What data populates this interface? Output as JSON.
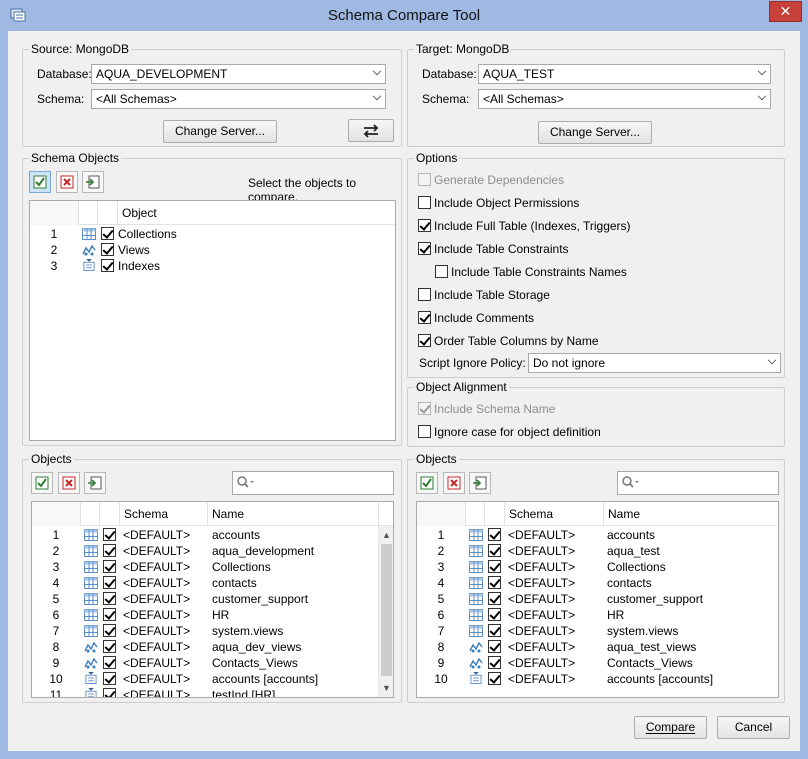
{
  "window": {
    "title": "Schema Compare Tool",
    "close_label": "✕"
  },
  "source": {
    "group_title": "Source: MongoDB",
    "database_label": "Database:",
    "database_value": "AQUA_DEVELOPMENT",
    "schema_label": "Schema:",
    "schema_value": "<All Schemas>",
    "change_server": "Change Server...",
    "swap_icon": "swap-arrows-icon"
  },
  "target": {
    "group_title": "Target: MongoDB",
    "database_label": "Database:",
    "database_value": "AQUA_TEST",
    "schema_label": "Schema:",
    "schema_value": "<All Schemas>",
    "change_server": "Change Server..."
  },
  "schema_objects": {
    "group_title": "Schema Objects",
    "hint": "Select the objects to compare.",
    "column_object": "Object",
    "rows": [
      {
        "n": "1",
        "label": "Collections",
        "icon": "table-icon"
      },
      {
        "n": "2",
        "label": "Views",
        "icon": "view-icon"
      },
      {
        "n": "3",
        "label": "Indexes",
        "icon": "index-icon"
      }
    ]
  },
  "options": {
    "group_title": "Options",
    "items": [
      {
        "label": "Generate Dependencies",
        "checked": false,
        "disabled": true
      },
      {
        "label": "Include Object Permissions",
        "checked": false,
        "disabled": false
      },
      {
        "label": "Include Full Table (Indexes, Triggers)",
        "checked": true,
        "disabled": false
      },
      {
        "label": "Include Table Constraints",
        "checked": true,
        "disabled": false
      },
      {
        "label": "Include Table Constraints Names",
        "checked": false,
        "disabled": false
      },
      {
        "label": "Include Table Storage",
        "checked": false,
        "disabled": false
      },
      {
        "label": "Include Comments",
        "checked": true,
        "disabled": false
      },
      {
        "label": "Order Table Columns by Name",
        "checked": true,
        "disabled": false
      }
    ],
    "ignore_policy_label": "Script Ignore Policy:",
    "ignore_policy_value": "Do not ignore"
  },
  "alignment": {
    "group_title": "Object Alignment",
    "items": [
      {
        "label": "Include Schema Name",
        "checked": true,
        "disabled": true
      },
      {
        "label": "Ignore case for object definition",
        "checked": false,
        "disabled": false
      }
    ]
  },
  "left_objects": {
    "group_title": "Objects",
    "col_schema": "Schema",
    "col_name": "Name",
    "rows": [
      {
        "n": "1",
        "schema": "<DEFAULT>",
        "name": "accounts",
        "icon": "table-icon"
      },
      {
        "n": "2",
        "schema": "<DEFAULT>",
        "name": "aqua_development",
        "icon": "table-icon"
      },
      {
        "n": "3",
        "schema": "<DEFAULT>",
        "name": "Collections",
        "icon": "table-icon"
      },
      {
        "n": "4",
        "schema": "<DEFAULT>",
        "name": "contacts",
        "icon": "table-icon"
      },
      {
        "n": "5",
        "schema": "<DEFAULT>",
        "name": "customer_support",
        "icon": "table-icon"
      },
      {
        "n": "6",
        "schema": "<DEFAULT>",
        "name": "HR",
        "icon": "table-icon"
      },
      {
        "n": "7",
        "schema": "<DEFAULT>",
        "name": "system.views",
        "icon": "table-icon"
      },
      {
        "n": "8",
        "schema": "<DEFAULT>",
        "name": "aqua_dev_views",
        "icon": "view-icon"
      },
      {
        "n": "9",
        "schema": "<DEFAULT>",
        "name": "Contacts_Views",
        "icon": "view-icon"
      },
      {
        "n": "10",
        "schema": "<DEFAULT>",
        "name": "accounts [accounts]",
        "icon": "index-icon"
      },
      {
        "n": "11",
        "schema": "<DEFAULT>",
        "name": "testInd [HR]",
        "icon": "index-icon"
      }
    ]
  },
  "right_objects": {
    "group_title": "Objects",
    "col_schema": "Schema",
    "col_name": "Name",
    "rows": [
      {
        "n": "1",
        "schema": "<DEFAULT>",
        "name": "accounts",
        "icon": "table-icon"
      },
      {
        "n": "2",
        "schema": "<DEFAULT>",
        "name": "aqua_test",
        "icon": "table-icon"
      },
      {
        "n": "3",
        "schema": "<DEFAULT>",
        "name": "Collections",
        "icon": "table-icon"
      },
      {
        "n": "4",
        "schema": "<DEFAULT>",
        "name": "contacts",
        "icon": "table-icon"
      },
      {
        "n": "5",
        "schema": "<DEFAULT>",
        "name": "customer_support",
        "icon": "table-icon"
      },
      {
        "n": "6",
        "schema": "<DEFAULT>",
        "name": "HR",
        "icon": "table-icon"
      },
      {
        "n": "7",
        "schema": "<DEFAULT>",
        "name": "system.views",
        "icon": "table-icon"
      },
      {
        "n": "8",
        "schema": "<DEFAULT>",
        "name": "aqua_test_views",
        "icon": "view-icon"
      },
      {
        "n": "9",
        "schema": "<DEFAULT>",
        "name": "Contacts_Views",
        "icon": "view-icon"
      },
      {
        "n": "10",
        "schema": "<DEFAULT>",
        "name": "accounts [accounts]",
        "icon": "index-icon"
      }
    ]
  },
  "footer": {
    "compare": "Compare",
    "cancel": "Cancel"
  },
  "colors": {
    "title_bar": "#9fb9e2",
    "close": "#c7403a",
    "panel": "#f0f0f0"
  }
}
